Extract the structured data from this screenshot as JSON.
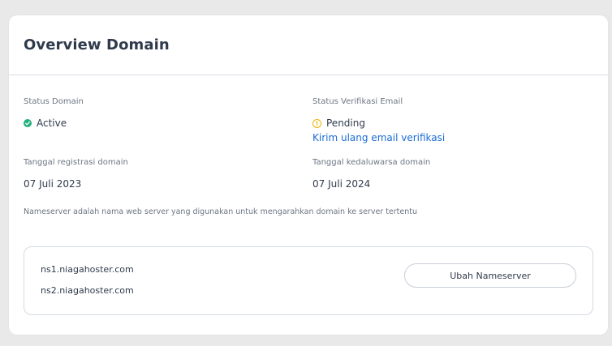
{
  "card": {
    "title": "Overview Domain"
  },
  "status": {
    "domain_label": "Status Domain",
    "domain_value": "Active",
    "email_label": "Status Verifikasi Email",
    "email_value": "Pending",
    "resend_link": "Kirim ulang email verifikasi"
  },
  "dates": {
    "registration_label": "Tanggal registrasi domain",
    "registration_value": "07 Juli 2023",
    "expiry_label": "Tanggal kedaluwarsa domain",
    "expiry_value": "07 Juli 2024"
  },
  "nameserver": {
    "note": "Nameserver adalah nama web server yang digunakan untuk mengarahkan domain ke server tertentu",
    "items": [
      "ns1.niagahoster.com",
      "ns2.niagahoster.com"
    ],
    "button_label": "Ubah Nameserver"
  },
  "colors": {
    "active": "#22b07d",
    "pending": "#f0b400",
    "link": "#1b6ad6"
  },
  "icons": {
    "active": "check-circle-icon",
    "pending": "info-circle-icon"
  }
}
